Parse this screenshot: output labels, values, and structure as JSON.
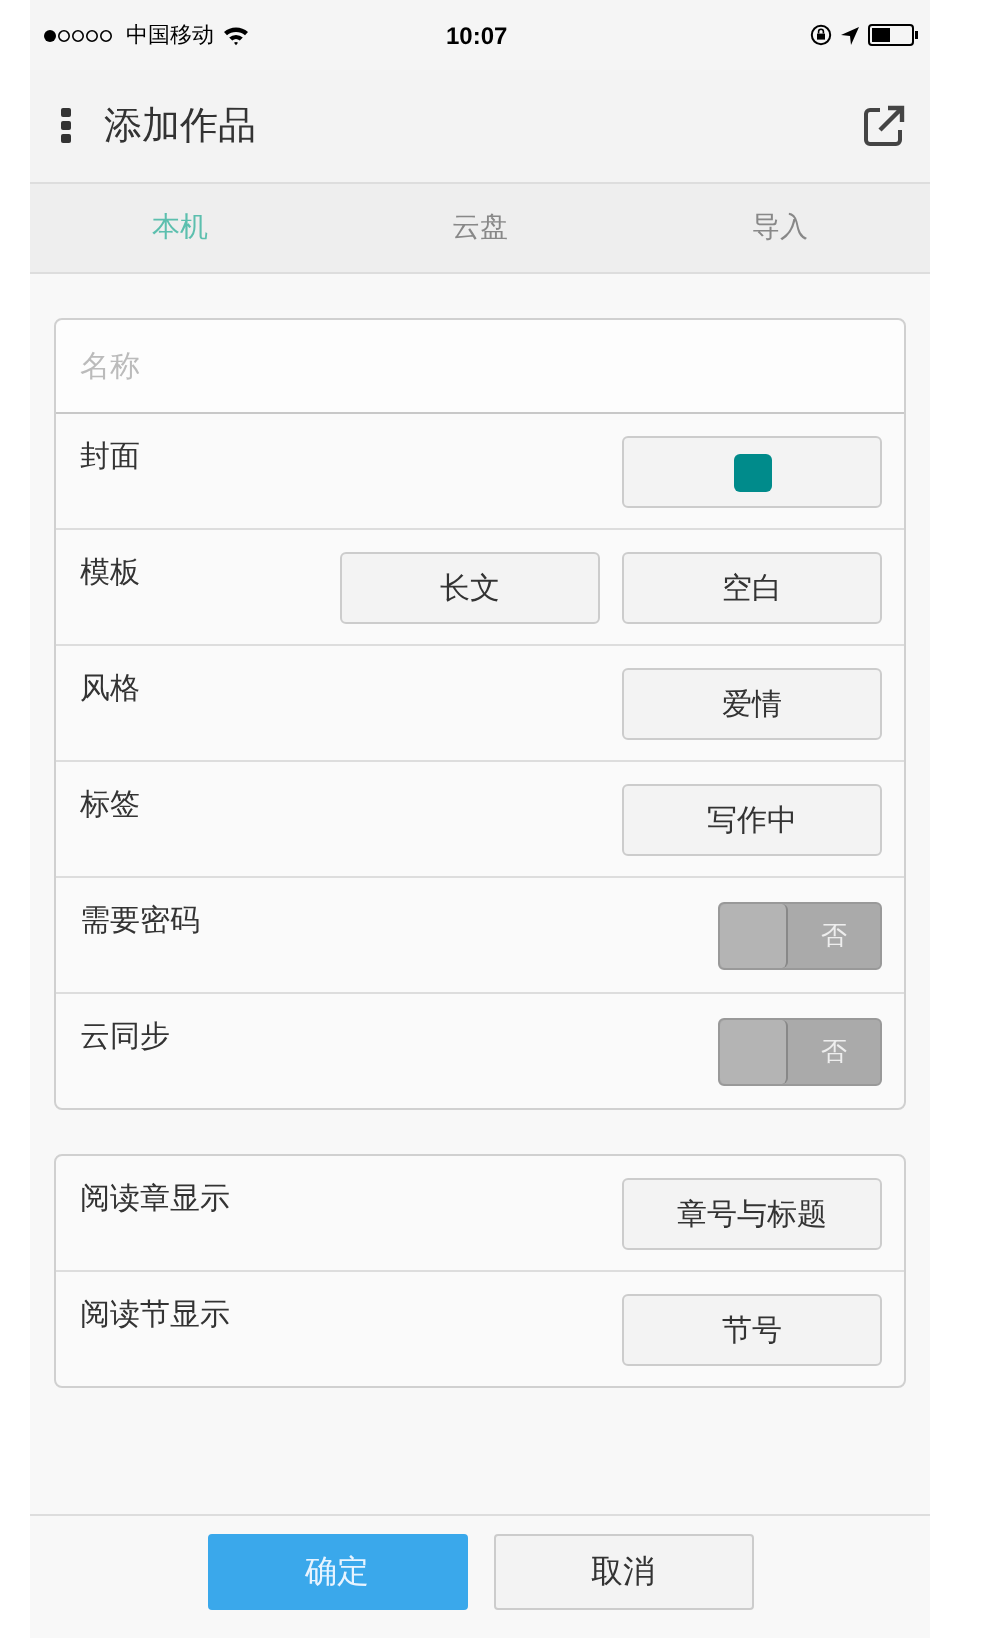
{
  "status_bar": {
    "carrier": "中国移动",
    "time": "10:07"
  },
  "header": {
    "title": "添加作品"
  },
  "tabs": [
    {
      "label": "本机",
      "selected": true
    },
    {
      "label": "云盘",
      "selected": false
    },
    {
      "label": "导入",
      "selected": false
    }
  ],
  "name_field": {
    "placeholder": "名称"
  },
  "settings": [
    {
      "kind": "color",
      "label": "封面",
      "color": "#008b8b"
    },
    {
      "kind": "buttons",
      "label": "模板",
      "buttons": [
        "长文",
        "空白"
      ]
    },
    {
      "kind": "buttons",
      "label": "风格",
      "buttons": [
        "爱情"
      ]
    },
    {
      "kind": "buttons",
      "label": "标签",
      "buttons": [
        "写作中"
      ]
    },
    {
      "kind": "toggle",
      "label": "需要密码",
      "on": false,
      "text": "否"
    },
    {
      "kind": "toggle",
      "label": "云同步",
      "on": false,
      "text": "否"
    }
  ],
  "reading": [
    {
      "kind": "buttons",
      "label": "阅读章显示",
      "buttons": [
        "章号与标题"
      ]
    },
    {
      "kind": "buttons",
      "label": "阅读节显示",
      "buttons": [
        "节号"
      ]
    }
  ],
  "footer": {
    "confirm": "确定",
    "cancel": "取消"
  }
}
